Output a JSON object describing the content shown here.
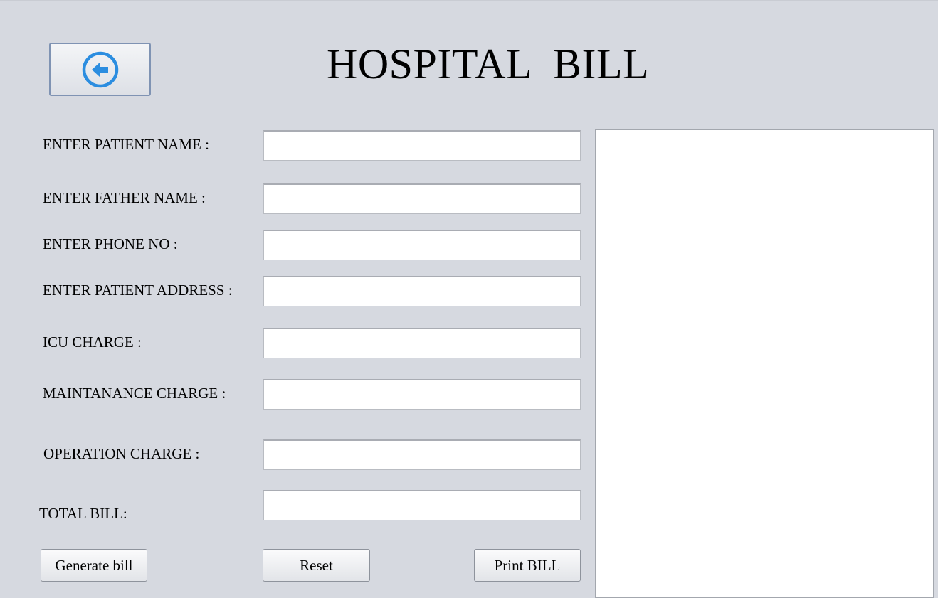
{
  "window": {
    "title": "HOSPITAL  BILL"
  },
  "header": {
    "back_icon": "arrow-left-circle-icon",
    "accent_color": "#2b8de0"
  },
  "form": {
    "patient_name": {
      "label": "ENTER PATIENT NAME :",
      "value": ""
    },
    "father_name": {
      "label": "ENTER FATHER NAME :",
      "value": ""
    },
    "phone_no": {
      "label": "ENTER PHONE NO :",
      "value": ""
    },
    "patient_address": {
      "label": "ENTER PATIENT ADDRESS :",
      "value": ""
    },
    "icu_charge": {
      "label": "ICU CHARGE :",
      "value": ""
    },
    "maintenance_charge": {
      "label": "MAINTANANCE CHARGE :",
      "value": ""
    },
    "operation_charge": {
      "label": "OPERATION CHARGE :",
      "value": ""
    },
    "total_bill": {
      "label": "TOTAL BILL:",
      "value": ""
    }
  },
  "buttons": {
    "generate": "Generate bill",
    "reset": "Reset",
    "print": "Print BILL"
  },
  "bill_preview": {
    "text": ""
  }
}
